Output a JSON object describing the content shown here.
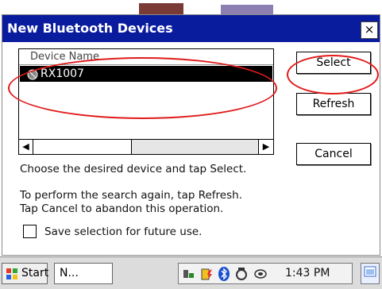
{
  "dialog": {
    "title": "New Bluetooth Devices",
    "close_glyph": "×",
    "list": {
      "header": "Device Name",
      "selected_device": "RX1007",
      "scroll_left": "◀",
      "scroll_right": "▶"
    },
    "buttons": {
      "select": "Select",
      "refresh": "Refresh",
      "cancel": "Cancel"
    },
    "messages": {
      "choose": "Choose the desired device and tap Select.",
      "refresh": "To perform the search again, tap Refresh.",
      "cancel": "Tap Cancel to abandon this operation."
    },
    "checkbox": {
      "label": "Save selection for future use.",
      "checked": false
    }
  },
  "taskbar": {
    "start_label": "Start",
    "task_label": "N...",
    "time": "1:43 PM",
    "tray_icons": [
      "network-icon",
      "battery-icon",
      "bluetooth-icon",
      "sync-icon",
      "volume-icon"
    ]
  },
  "colors": {
    "titlebar": "#0a1c9e",
    "annotation": "#e01b1b",
    "selection": "#000000"
  }
}
